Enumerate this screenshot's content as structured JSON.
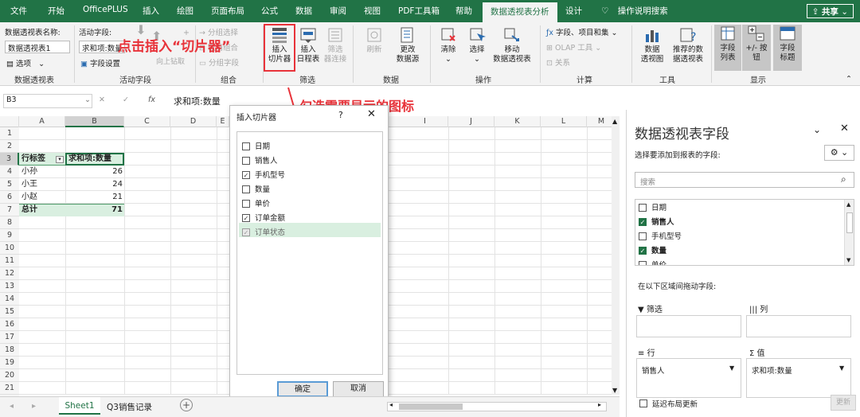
{
  "tabs": [
    "文件",
    "开始",
    "OfficePLUS",
    "插入",
    "绘图",
    "页面布局",
    "公式",
    "数据",
    "审阅",
    "视图",
    "PDF工具箱",
    "帮助",
    "数据透视表分析",
    "设计"
  ],
  "tell_me": "操作说明搜索",
  "share": "共享",
  "ribbon": {
    "pt_name_label": "数据透视表名称:",
    "pt_name_value": "数据透视表1",
    "options": "选项",
    "pt_group": "数据透视表",
    "active_field_label": "活动字段:",
    "active_field_value": "求和项:数量",
    "field_settings": "字段设置",
    "drill_down": "向下钻取",
    "drill_up": "向上钻取",
    "expand_label": "展开字段",
    "collapse_label": "折叠字段",
    "active_group": "活动字段",
    "group_selection": "分组选择",
    "ungroup": "取消组合",
    "group_field": "分组字段",
    "group_group": "组合",
    "insert_slicer": "插入\n切片器",
    "insert_timeline": "插入\n日程表",
    "filter_conn": "筛选\n器连接",
    "filter_group": "筛选",
    "refresh": "刷新",
    "change_source": "更改\n数据源",
    "data_group": "数据",
    "clear": "清除",
    "select": "选择",
    "move_pt": "移动\n数据透视表",
    "ops_group": "操作",
    "fields_items": "字段、项目和集",
    "olap": "OLAP 工具",
    "relations": "关系",
    "calc_group": "计算",
    "pivot_chart": "数据\n透视图",
    "recommended": "推荐的数\n据透视表",
    "tools_group": "工具",
    "field_list": "字段\n列表",
    "pm_buttons": "+/- 按钮",
    "field_headers": "字段\n标题",
    "show_group": "显示"
  },
  "annotations": {
    "click_insert": "点击插入“切片器”",
    "check_fields": "勾选需要显示的图标"
  },
  "formula_bar": {
    "name_box": "B3",
    "fx": "fx",
    "content": "求和项:数量"
  },
  "columns": [
    "A",
    "B",
    "C",
    "D",
    "E",
    "I",
    "J",
    "K",
    "L",
    "M"
  ],
  "rows": [
    "1",
    "2",
    "3",
    "4",
    "5",
    "6",
    "7",
    "8",
    "9",
    "10",
    "11",
    "12",
    "13",
    "14",
    "15",
    "16",
    "17",
    "18",
    "19",
    "20",
    "21",
    "22"
  ],
  "cells": {
    "a3": "行标签",
    "b3": "求和项:数量",
    "a4": "小孙",
    "b4": "26",
    "a5": "小王",
    "b5": "24",
    "a6": "小赵",
    "b6": "21",
    "a7": "总计",
    "b7": "71"
  },
  "dialog": {
    "title": "插入切片器",
    "help": "?",
    "items": [
      {
        "label": "日期",
        "checked": false,
        "disabled": false
      },
      {
        "label": "销售人",
        "checked": false,
        "disabled": false
      },
      {
        "label": "手机型号",
        "checked": true,
        "disabled": false
      },
      {
        "label": "数量",
        "checked": false,
        "disabled": false
      },
      {
        "label": "单价",
        "checked": false,
        "disabled": false
      },
      {
        "label": "订单金额",
        "checked": true,
        "disabled": false
      },
      {
        "label": "订单状态",
        "checked": true,
        "disabled": true
      }
    ],
    "ok": "确定",
    "cancel": "取消"
  },
  "pane": {
    "title": "数据透视表字段",
    "choose_label": "选择要添加到报表的字段:",
    "search_placeholder": "搜索",
    "fields": [
      {
        "label": "日期",
        "checked": false,
        "bold": false
      },
      {
        "label": "销售人",
        "checked": true,
        "bold": true
      },
      {
        "label": "手机型号",
        "checked": false,
        "bold": false
      },
      {
        "label": "数量",
        "checked": true,
        "bold": true
      },
      {
        "label": "单价",
        "checked": false,
        "bold": false
      }
    ],
    "drag_label": "在以下区域间拖动字段:",
    "filters": "筛选",
    "columns": "列",
    "rows": "行",
    "values": "值",
    "rows_value": "销售人",
    "values_value": "求和项:数量",
    "defer": "延迟布局更新",
    "update": "更新"
  },
  "sheets": [
    "Sheet1",
    "Q3销售记录"
  ],
  "colors": {
    "excel_green": "#217346",
    "annotation_red": "#e8333a",
    "highlight": "#d9efe0"
  }
}
